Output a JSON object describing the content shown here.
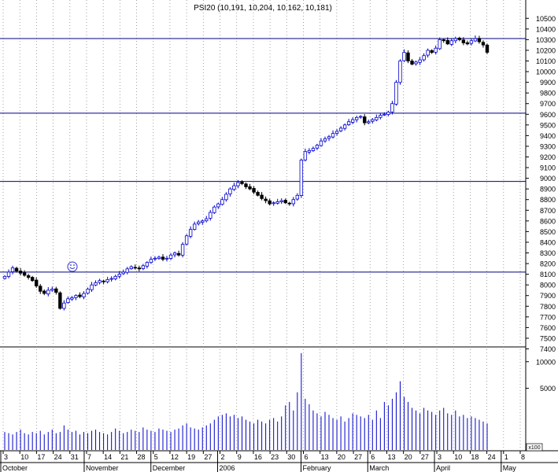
{
  "chart_data": [
    {
      "type": "candlestick",
      "title": "PSI20 (10,191, 10,204, 10,162, 10,181)",
      "ylim": [
        7400,
        10550
      ],
      "y_scale": "linear",
      "y_ticks": [
        7400,
        7500,
        7600,
        7700,
        7800,
        7900,
        8000,
        8100,
        8200,
        8300,
        8400,
        8500,
        8600,
        8700,
        8800,
        8900,
        9000,
        9100,
        9200,
        9300,
        9400,
        9500,
        9600,
        9700,
        9800,
        9900,
        10000,
        10100,
        10200,
        10300,
        10400,
        10500
      ],
      "reference_lines": [
        10310,
        9610,
        8970,
        8120
      ],
      "grid": "vertical dotted lines at weekly ticks",
      "annotation": "smiley-icon",
      "colors": {
        "up": "#0000cc",
        "down": "#000000",
        "lines": "#000080"
      },
      "closes": [
        8080,
        8120,
        8160,
        8130,
        8110,
        8090,
        8070,
        8040,
        7990,
        7940,
        7920,
        7950,
        7960,
        7930,
        7780,
        7830,
        7870,
        7880,
        7900,
        7890,
        7920,
        7960,
        8000,
        8020,
        8040,
        8030,
        8050,
        8060,
        8080,
        8100,
        8120,
        8150,
        8170,
        8160,
        8150,
        8180,
        8210,
        8240,
        8250,
        8260,
        8240,
        8250,
        8280,
        8300,
        8280,
        8380,
        8460,
        8520,
        8570,
        8590,
        8600,
        8620,
        8680,
        8730,
        8760,
        8800,
        8850,
        8900,
        8930,
        8960,
        8950,
        8920,
        8900,
        8870,
        8840,
        8810,
        8790,
        8760,
        8770,
        8780,
        8790,
        8770,
        8760,
        8800,
        8840,
        9170,
        9250,
        9260,
        9280,
        9310,
        9350,
        9370,
        9390,
        9420,
        9440,
        9470,
        9500,
        9530,
        9550,
        9570,
        9580,
        9520,
        9530,
        9550,
        9570,
        9590,
        9600,
        9620,
        9700,
        9900,
        10100,
        10180,
        10100,
        10070,
        10090,
        10110,
        10150,
        10200,
        10180,
        10220,
        10300,
        10290,
        10260,
        10290,
        10310,
        10300,
        10270,
        10260,
        10290,
        10310,
        10280,
        10250,
        10181
      ],
      "x_tick_labels": [
        "3",
        "10",
        "17",
        "24",
        "31",
        "7",
        "14",
        "21",
        "28",
        "5",
        "12",
        "19",
        "27",
        "2",
        "9",
        "16",
        "23",
        "30",
        "6",
        "13",
        "20",
        "27",
        "6",
        "13",
        "20",
        "27",
        "3",
        "10",
        "18",
        "24",
        "1",
        "8"
      ],
      "month_labels": [
        "October",
        "November",
        "December",
        "2006",
        "February",
        "March",
        "April",
        "May"
      ]
    },
    {
      "type": "bar",
      "title": "",
      "y_scale": "log",
      "ylim": [
        1000,
        15000
      ],
      "y_ticks": [
        5000,
        10000
      ],
      "y_tick_labels": [
        "5000",
        "10000"
      ],
      "units_label": "x100",
      "values": [
        1600,
        1550,
        1500,
        1600,
        1700,
        1550,
        1500,
        1600,
        1550,
        1650,
        1500,
        1600,
        1700,
        1550,
        1600,
        1900,
        1700,
        1600,
        1650,
        1500,
        1600,
        1550,
        1650,
        1700,
        1600,
        1550,
        1500,
        1600,
        1750,
        1650,
        1550,
        1600,
        1700,
        1650,
        1600,
        1800,
        1700,
        1650,
        1600,
        1750,
        1700,
        1650,
        1600,
        1700,
        1750,
        1900,
        2000,
        1800,
        1750,
        1700,
        1800,
        1900,
        2000,
        2200,
        2400,
        2500,
        2600,
        2400,
        2500,
        2300,
        2400,
        2200,
        2100,
        2000,
        2200,
        2100,
        2000,
        2200,
        2300,
        2100,
        2400,
        3200,
        3500,
        2800,
        4500,
        12500,
        3800,
        3300,
        2800,
        2600,
        2400,
        2700,
        2500,
        2300,
        2200,
        2400,
        2100,
        2300,
        2600,
        2500,
        2400,
        2300,
        2500,
        2200,
        2800,
        2300,
        3500,
        3200,
        3800,
        4500,
        6000,
        4000,
        3500,
        3000,
        2800,
        2600,
        3000,
        2800,
        2700,
        2500,
        2800,
        3000,
        2600,
        2500,
        2800,
        2400,
        2500,
        2300,
        2400,
        2300,
        2200,
        2100,
        2000
      ]
    }
  ]
}
